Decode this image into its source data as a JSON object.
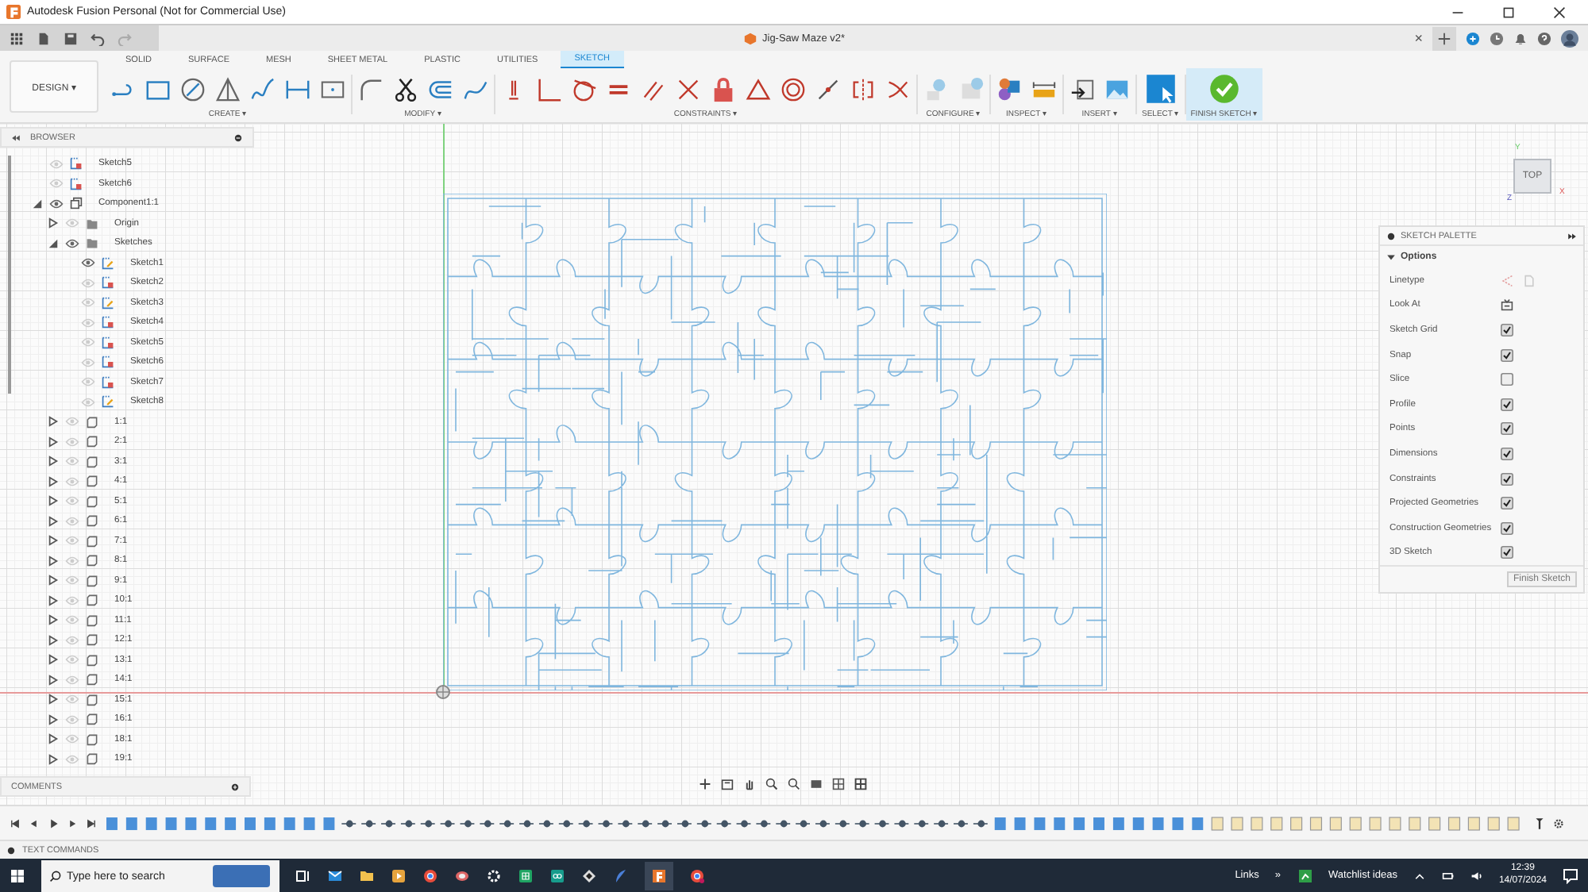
{
  "window": {
    "title": "Autodesk Fusion Personal (Not for Commercial Use)"
  },
  "document_tab": {
    "title": "Jig-Saw Maze v2*",
    "close": "×"
  },
  "workspace": {
    "label": "DESIGN",
    "caret": "▾"
  },
  "tabs": [
    {
      "label": "SOLID",
      "selected": false
    },
    {
      "label": "SURFACE",
      "selected": false
    },
    {
      "label": "MESH",
      "selected": false
    },
    {
      "label": "SHEET METAL",
      "selected": false
    },
    {
      "label": "PLASTIC",
      "selected": false
    },
    {
      "label": "UTILITIES",
      "selected": false
    },
    {
      "label": "SKETCH",
      "selected": true
    }
  ],
  "tool_groups": [
    {
      "label": "CREATE ▾",
      "kind": "create"
    },
    {
      "label": "MODIFY ▾",
      "kind": "modify"
    },
    {
      "label": "CONSTRAINTS ▾",
      "kind": "constraints"
    },
    {
      "label": "CONFIGURE ▾",
      "kind": "configure"
    },
    {
      "label": "INSPECT ▾",
      "kind": "inspect"
    },
    {
      "label": "INSERT ▾",
      "kind": "insert"
    },
    {
      "label": "SELECT ▾",
      "kind": "select"
    },
    {
      "label": "FINISH SKETCH ▾",
      "kind": "finish"
    }
  ],
  "browser": {
    "title": "BROWSER",
    "items": [
      {
        "label": "Sketch5",
        "kind": "sketch",
        "visible": false,
        "locked": true
      },
      {
        "label": "Sketch6",
        "kind": "sketch",
        "visible": false,
        "locked": true
      },
      {
        "label": "Component1:1",
        "kind": "component",
        "visible": true,
        "expanded": true,
        "children": [
          {
            "label": "Origin",
            "kind": "folder",
            "visible": false,
            "expanded": false
          },
          {
            "label": "Sketches",
            "kind": "folder",
            "visible": true,
            "expanded": true,
            "children": [
              {
                "label": "Sketch1",
                "kind": "sketch",
                "visible": true,
                "locked": false
              },
              {
                "label": "Sketch2",
                "kind": "sketch",
                "visible": false,
                "locked": true
              },
              {
                "label": "Sketch3",
                "kind": "sketch",
                "visible": false,
                "locked": false
              },
              {
                "label": "Sketch4",
                "kind": "sketch",
                "visible": false,
                "locked": true
              },
              {
                "label": "Sketch5",
                "kind": "sketch",
                "visible": false,
                "locked": true
              },
              {
                "label": "Sketch6",
                "kind": "sketch",
                "visible": false,
                "locked": true
              },
              {
                "label": "Sketch7",
                "kind": "sketch",
                "visible": false,
                "locked": true
              },
              {
                "label": "Sketch8",
                "kind": "sketch",
                "visible": false,
                "locked": false
              }
            ]
          },
          {
            "label": "1:1",
            "kind": "body",
            "visible": false,
            "expanded": false
          },
          {
            "label": "2:1",
            "kind": "body",
            "visible": false,
            "expanded": false
          },
          {
            "label": "3:1",
            "kind": "body",
            "visible": false,
            "expanded": false
          },
          {
            "label": "4:1",
            "kind": "body",
            "visible": false,
            "expanded": false
          },
          {
            "label": "5:1",
            "kind": "body",
            "visible": false,
            "expanded": false
          },
          {
            "label": "6:1",
            "kind": "body",
            "visible": false,
            "expanded": false
          },
          {
            "label": "7:1",
            "kind": "body",
            "visible": false,
            "expanded": false
          },
          {
            "label": "8:1",
            "kind": "body",
            "visible": false,
            "expanded": false
          },
          {
            "label": "9:1",
            "kind": "body",
            "visible": false,
            "expanded": false
          },
          {
            "label": "10:1",
            "kind": "body",
            "visible": false,
            "expanded": false
          },
          {
            "label": "11:1",
            "kind": "body",
            "visible": false,
            "expanded": false
          },
          {
            "label": "12:1",
            "kind": "body",
            "visible": false,
            "expanded": false
          },
          {
            "label": "13:1",
            "kind": "body",
            "visible": false,
            "expanded": false
          },
          {
            "label": "14:1",
            "kind": "body",
            "visible": false,
            "expanded": false
          },
          {
            "label": "15:1",
            "kind": "body",
            "visible": false,
            "expanded": false
          },
          {
            "label": "16:1",
            "kind": "body",
            "visible": false,
            "expanded": false
          },
          {
            "label": "18:1",
            "kind": "body",
            "visible": false,
            "expanded": false
          },
          {
            "label": "19:1",
            "kind": "body",
            "visible": false,
            "expanded": false
          }
        ]
      }
    ]
  },
  "viewcube": {
    "face": "TOP",
    "axes": [
      "Y",
      "Z",
      "X"
    ]
  },
  "sketch_palette": {
    "title": "SKETCH PALETTE",
    "section": "Options",
    "button": "Finish Sketch",
    "options": [
      {
        "label": "Linetype",
        "kind": "linetype"
      },
      {
        "label": "Look At",
        "kind": "look_at"
      },
      {
        "label": "Sketch Grid",
        "kind": "checkbox",
        "checked": true
      },
      {
        "label": "Snap",
        "kind": "checkbox",
        "checked": true
      },
      {
        "label": "Slice",
        "kind": "checkbox",
        "checked": false
      },
      {
        "label": "Profile",
        "kind": "checkbox",
        "checked": true
      },
      {
        "label": "Points",
        "kind": "checkbox",
        "checked": true
      },
      {
        "label": "Dimensions",
        "kind": "checkbox",
        "checked": true
      },
      {
        "label": "Constraints",
        "kind": "checkbox",
        "checked": true
      },
      {
        "label": "Projected Geometries",
        "kind": "checkbox",
        "checked": true
      },
      {
        "label": "Construction Geometries",
        "kind": "checkbox",
        "checked": true
      },
      {
        "label": "3D Sketch",
        "kind": "checkbox",
        "checked": true
      }
    ]
  },
  "comments": {
    "title": "COMMENTS"
  },
  "text_commands": {
    "title": "TEXT COMMANDS"
  },
  "taskbar": {
    "search_placeholder": "Type here to search",
    "links": "Links",
    "links_more": "»",
    "widget": "Watchlist ideas",
    "time": "12:39",
    "date": "14/07/2024"
  }
}
